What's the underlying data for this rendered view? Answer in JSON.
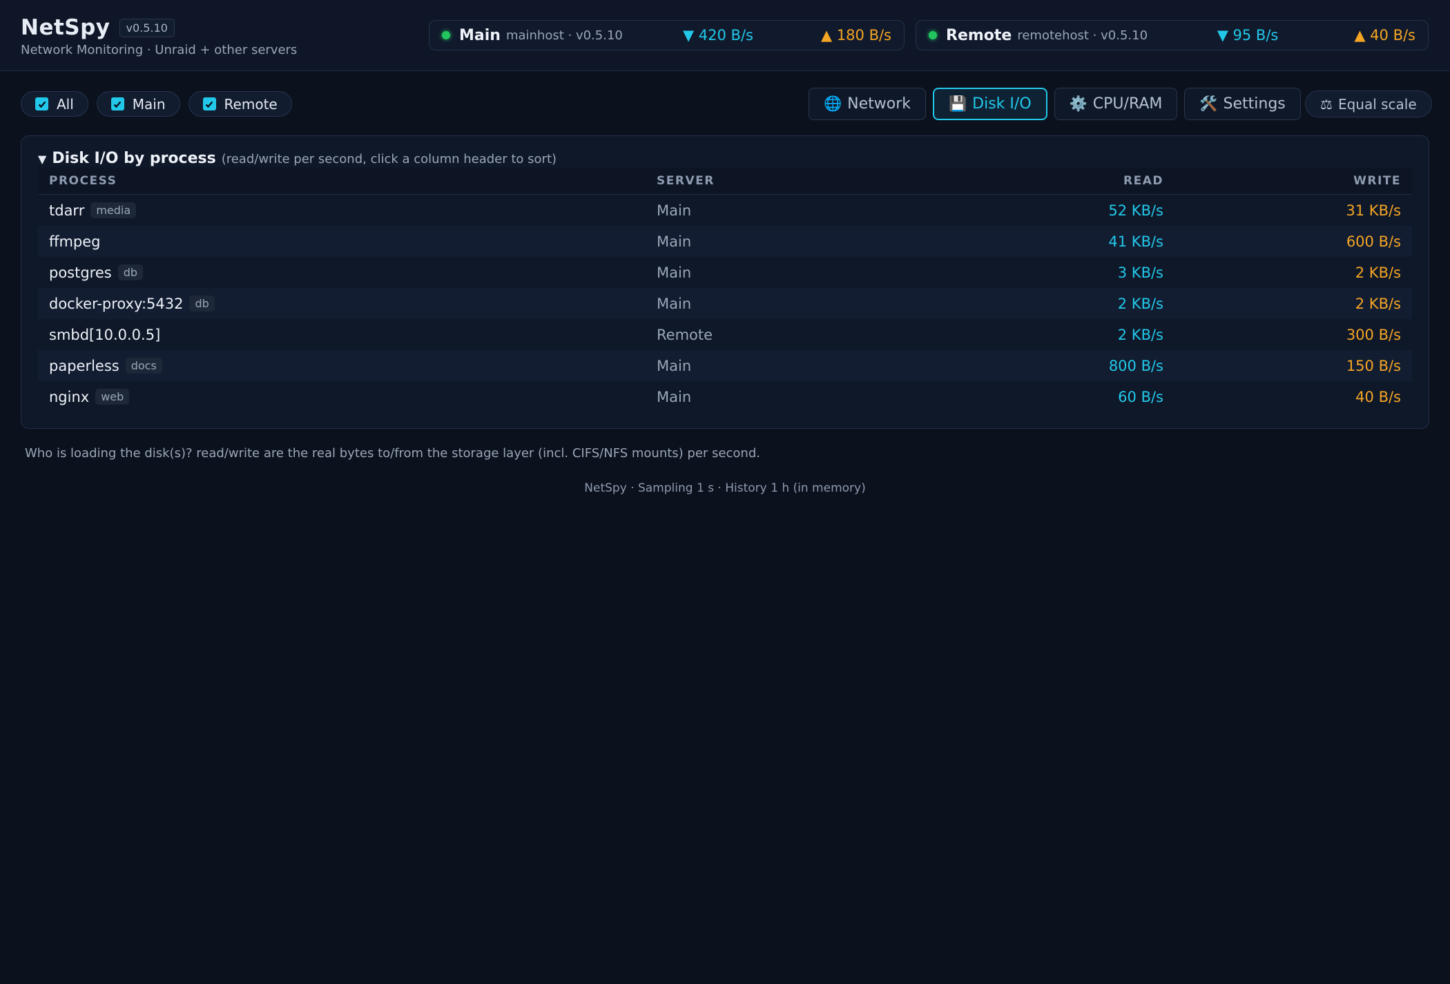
{
  "header": {
    "title": "NetSpy",
    "version": "v0.5.10",
    "subtitle": "Network Monitoring · Unraid + other servers"
  },
  "servers": [
    {
      "name": "Main",
      "host": "mainhost · v0.5.10",
      "status": "online",
      "down": "▼ 420 B/s",
      "up": "▲ 180 B/s"
    },
    {
      "name": "Remote",
      "host": "remotehost · v0.5.10",
      "status": "online",
      "down": "▼ 95 B/s",
      "up": "▲ 40 B/s"
    }
  ],
  "filters": [
    {
      "label": "All",
      "checked": true
    },
    {
      "label": "Main",
      "checked": true
    },
    {
      "label": "Remote",
      "checked": true
    }
  ],
  "tabs": [
    {
      "icon": "globe-icon",
      "glyph": "🌐",
      "label": "Network",
      "active": false
    },
    {
      "icon": "floppy-disk-icon",
      "glyph": "💾",
      "label": "Disk I/O",
      "active": true
    },
    {
      "icon": "gear-icon",
      "glyph": "⚙️",
      "label": "CPU/RAM",
      "active": false
    },
    {
      "icon": "tools-icon",
      "glyph": "🛠️",
      "label": "Settings",
      "active": false
    }
  ],
  "equal_scale": {
    "icon": "scales-icon",
    "glyph": "⚖",
    "label": "Equal scale"
  },
  "panel": {
    "caret": "▼",
    "heading": "Disk I/O by process",
    "hint": "(read/write per second, click a column header to sort)",
    "columns": [
      "PROCESS",
      "SERVER",
      "READ",
      "WRITE"
    ],
    "rows": [
      {
        "process": "tdarr",
        "tag": "media",
        "server": "Main",
        "read": "52 KB/s",
        "write": "31 KB/s"
      },
      {
        "process": "ffmpeg",
        "tag": "",
        "server": "Main",
        "read": "41 KB/s",
        "write": "600 B/s"
      },
      {
        "process": "postgres",
        "tag": "db",
        "server": "Main",
        "read": "3 KB/s",
        "write": "2 KB/s"
      },
      {
        "process": "docker-proxy:5432",
        "tag": "db",
        "server": "Main",
        "read": "2 KB/s",
        "write": "2 KB/s"
      },
      {
        "process": "smbd[10.0.0.5]",
        "tag": "",
        "server": "Remote",
        "read": "2 KB/s",
        "write": "300 B/s"
      },
      {
        "process": "paperless",
        "tag": "docs",
        "server": "Main",
        "read": "800 B/s",
        "write": "150 B/s"
      },
      {
        "process": "nginx",
        "tag": "web",
        "server": "Main",
        "read": "60 B/s",
        "write": "40 B/s"
      }
    ]
  },
  "footnote": "Who is loading the disk(s)? read/write are the real bytes to/from the storage layer (incl. CIFS/NFS mounts) per second.",
  "footer": "NetSpy · Sampling 1 s · History 1 h (in memory)",
  "colors": {
    "accent": "#22c8ea",
    "write": "#f5a524",
    "online": "#22c55e",
    "background": "#0b111d"
  }
}
